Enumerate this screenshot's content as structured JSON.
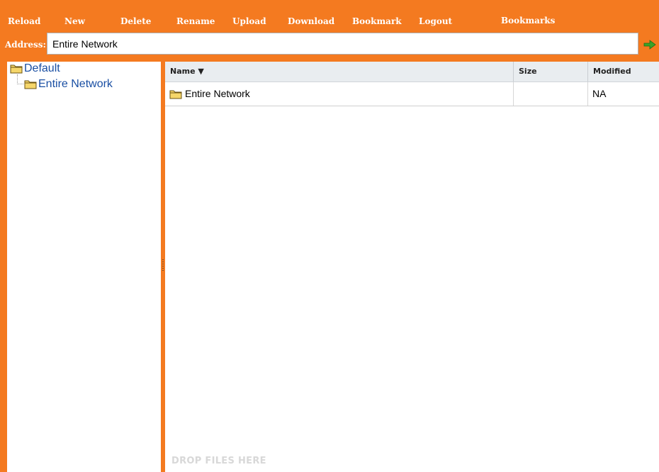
{
  "toolbar": {
    "buttons": [
      "Reload",
      "New",
      "Delete",
      "Rename",
      "Upload",
      "Download",
      "Bookmark",
      "Logout"
    ],
    "bookmarks_label": "Bookmarks"
  },
  "address": {
    "label": "Address:",
    "value": "Entire Network",
    "go_icon": "arrow-right-icon"
  },
  "tree": {
    "root": "Default",
    "children": [
      "Entire Network"
    ]
  },
  "file_list": {
    "columns": {
      "name": "Name ▼",
      "size": "Size",
      "modified": "Modified"
    },
    "rows": [
      {
        "name": "Entire Network",
        "size": "",
        "modified": "NA",
        "icon": "folder-icon"
      }
    ],
    "drop_hint": "DROP FILES HERE"
  },
  "colors": {
    "accent": "#f47a20",
    "tree_link": "#1a4fa3",
    "header_bg": "#e9edf0",
    "go_arrow": "#3aa329"
  }
}
